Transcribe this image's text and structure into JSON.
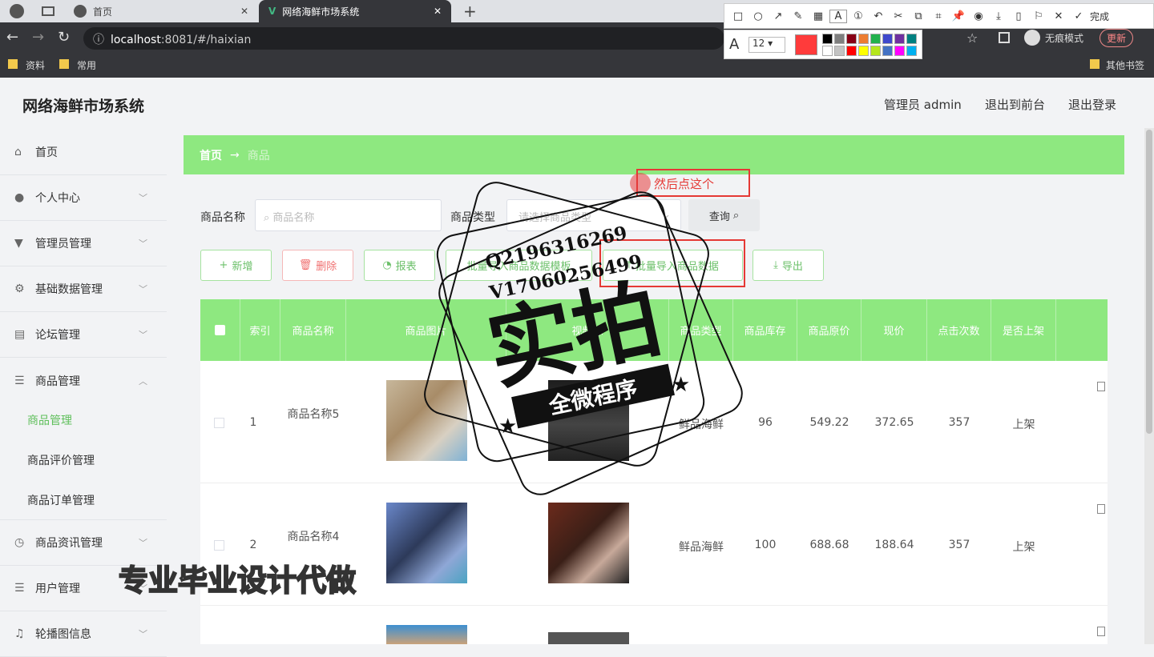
{
  "browser": {
    "tabs": [
      {
        "label": "首页"
      },
      {
        "label": "网络海鲜市场系统"
      }
    ],
    "url_host": "localhost",
    "url_rest": ":8081/#/haixian",
    "bookmarks": [
      "资料",
      "常用"
    ],
    "other_bookmarks": "其他书签",
    "incognito": "无痕模式",
    "update": "更新"
  },
  "annotation_toolbar": {
    "done": "完成",
    "font_size": "12",
    "colors": [
      "#000000",
      "#7f7f7f",
      "#880015",
      "#ed7d31",
      "#22b14c",
      "#3f48cc",
      "#7030a0",
      "#008080",
      "#ffffff",
      "#c3c3c3",
      "#ff0000",
      "#ffff00",
      "#b5e61d",
      "#4472c4",
      "#ff00ff",
      "#00b0f0"
    ],
    "active_color": "#ff3b3b",
    "annotation_text": "然后点这个"
  },
  "app": {
    "title": "网络海鲜市场系统",
    "user": "管理员 admin",
    "to_front": "退出到前台",
    "logout": "退出登录",
    "accent": "#8ee880"
  },
  "sidebar": {
    "items": [
      {
        "label": "首页",
        "icon": "home-icon"
      },
      {
        "label": "个人中心",
        "icon": "user-icon"
      },
      {
        "label": "管理员管理",
        "icon": "admin-icon"
      },
      {
        "label": "基础数据管理",
        "icon": "settings-icon"
      },
      {
        "label": "论坛管理",
        "icon": "forum-icon"
      },
      {
        "label": "商品管理",
        "icon": "list-icon"
      },
      {
        "label": "商品资讯管理",
        "icon": "clock-icon"
      },
      {
        "label": "用户管理",
        "icon": "list-icon"
      },
      {
        "label": "轮播图信息",
        "icon": "bell-icon"
      }
    ],
    "sub_items": [
      "商品管理",
      "商品评价管理",
      "商品订单管理"
    ]
  },
  "breadcrumb": {
    "home": "首页",
    "arrow": "→",
    "current": "商品"
  },
  "search": {
    "name_label": "商品名称",
    "name_placeholder": "商品名称",
    "type_label": "商品类型",
    "type_placeholder": "请选择商品类型",
    "query_button": "查询"
  },
  "actions": {
    "add": "新增",
    "delete": "删除",
    "report": "报表",
    "template": "批量导入商品数据模板",
    "import": "批量导入商品数据",
    "export": "导出"
  },
  "table": {
    "headers": [
      "索引",
      "商品名称",
      "商品图片",
      "视频源",
      "商品类型",
      "商品库存",
      "商品原价",
      "现价",
      "点击次数",
      "是否上架"
    ],
    "rows": [
      {
        "index": "1",
        "name": "商品名称5",
        "type": "鲜品海鲜",
        "stock": "96",
        "original": "549.22",
        "price": "372.65",
        "clicks": "357",
        "onsale": "上架"
      },
      {
        "index": "2",
        "name": "商品名称4",
        "type": "鲜品海鲜",
        "stock": "100",
        "original": "688.68",
        "price": "188.64",
        "clicks": "357",
        "onsale": "上架"
      }
    ]
  },
  "watermark": {
    "qq": "Q2196316269",
    "v": "V17060256499",
    "big": "实拍",
    "ribbon": "全微程序",
    "bottom": "专业毕业设计代做"
  }
}
